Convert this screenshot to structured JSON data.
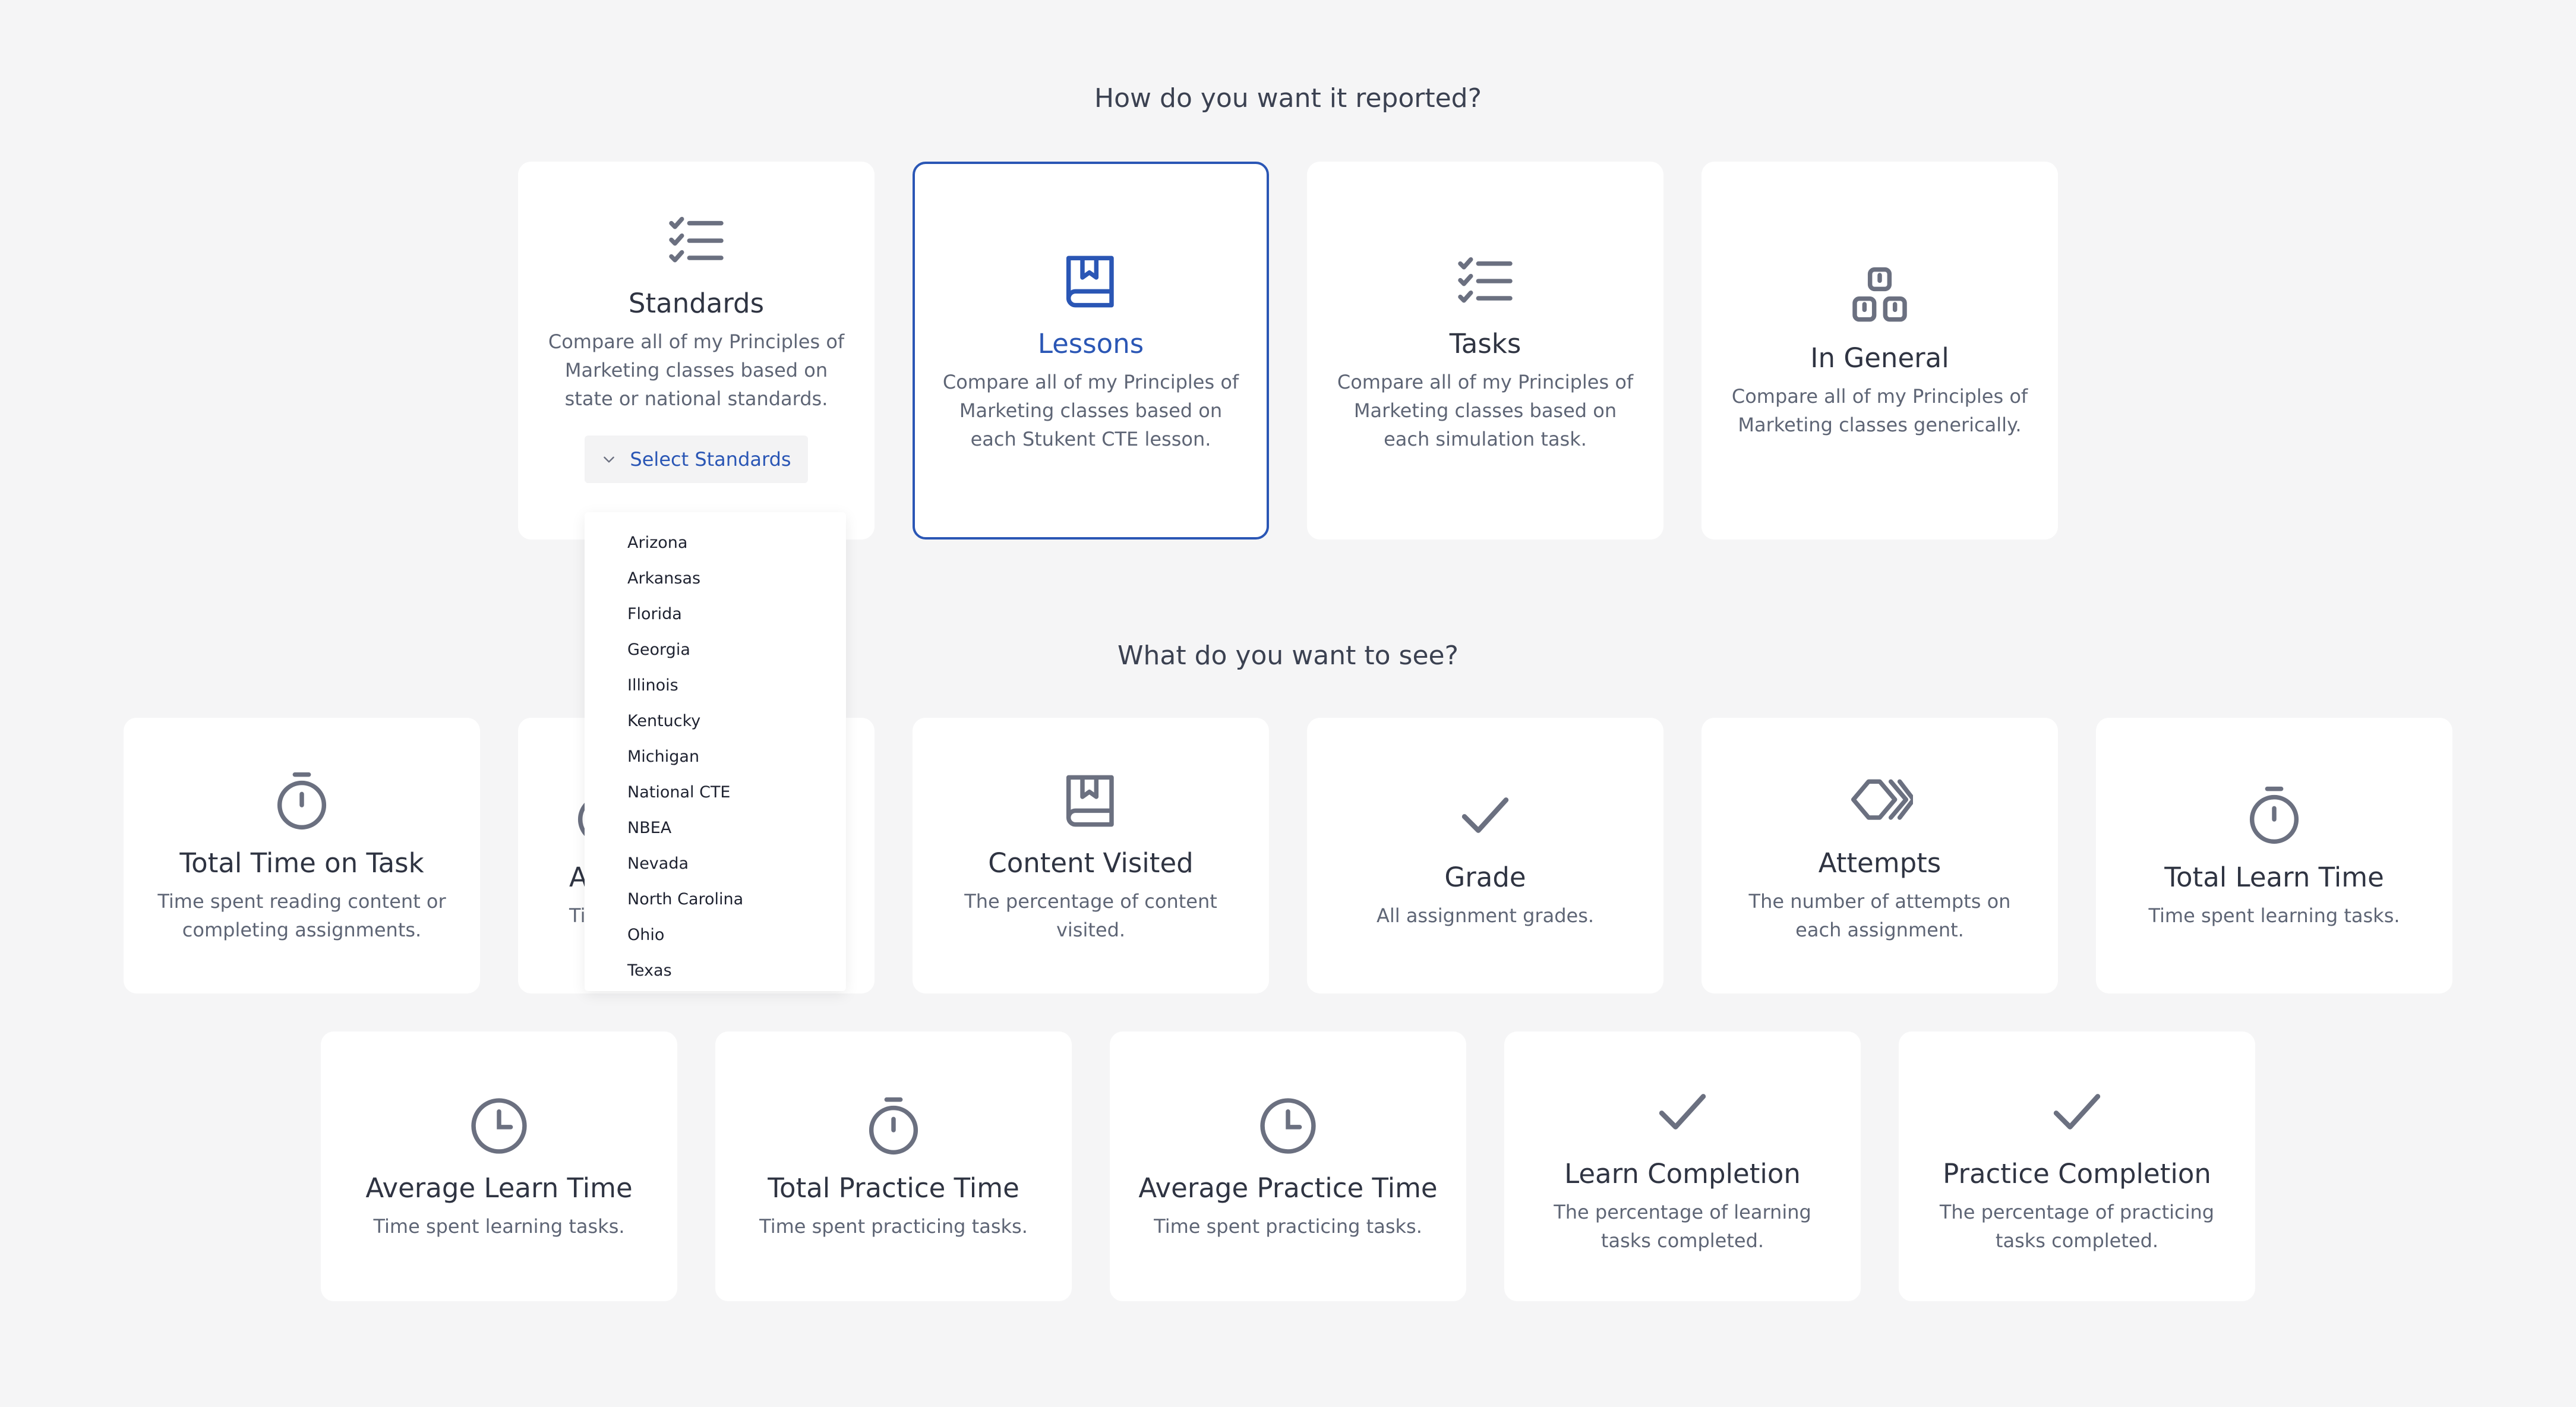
{
  "report_section": {
    "heading": "How do you want it reported?",
    "cards": {
      "standards": {
        "title": "Standards",
        "desc": "Compare all of my Principles of Marketing classes based on state or national standards.",
        "select_label": "Select Standards"
      },
      "lessons": {
        "title": "Lessons",
        "desc": "Compare all of my Principles of Marketing classes based on each Stukent CTE lesson."
      },
      "tasks": {
        "title": "Tasks",
        "desc": "Compare all of my Principles of Marketing classes based on each simulation task."
      },
      "general": {
        "title": "In General",
        "desc": "Compare all of my Principles of Marketing classes generically."
      }
    }
  },
  "standards_dropdown": {
    "options": [
      "Arizona",
      "Arkansas",
      "Florida",
      "Georgia",
      "Illinois",
      "Kentucky",
      "Michigan",
      "National CTE",
      "NBEA",
      "Nevada",
      "North Carolina",
      "Ohio",
      "Texas"
    ]
  },
  "see_section": {
    "heading": "What do you want to see?",
    "metrics": {
      "total_time_on_task": {
        "title": "Total Time on Task",
        "desc": "Time spent reading content or completing assignments."
      },
      "average_time_on_task": {
        "title": "A",
        "desc": "Ti"
      },
      "content_visited": {
        "title": "Content Visited",
        "desc": "The percentage of content visited."
      },
      "grade": {
        "title": "Grade",
        "desc": "All assignment grades."
      },
      "attempts": {
        "title": "Attempts",
        "desc": "The number of attempts on each assignment."
      },
      "total_learn_time": {
        "title": "Total Learn Time",
        "desc": "Time spent learning tasks."
      },
      "average_learn_time": {
        "title": "Average Learn Time",
        "desc": "Time spent learning tasks."
      },
      "total_practice_time": {
        "title": "Total Practice Time",
        "desc": "Time spent practicing tasks."
      },
      "average_practice_time": {
        "title": "Average Practice Time",
        "desc": "Time spent practicing tasks."
      },
      "learn_completion": {
        "title": "Learn Completion",
        "desc": "The percentage of learning tasks completed."
      },
      "practice_completion": {
        "title": "Practice Completion",
        "desc": "The percentage of practicing tasks completed."
      }
    }
  },
  "colors": {
    "accent": "#2a56b5",
    "icon": "#6b7080",
    "background": "#f5f5f6"
  }
}
